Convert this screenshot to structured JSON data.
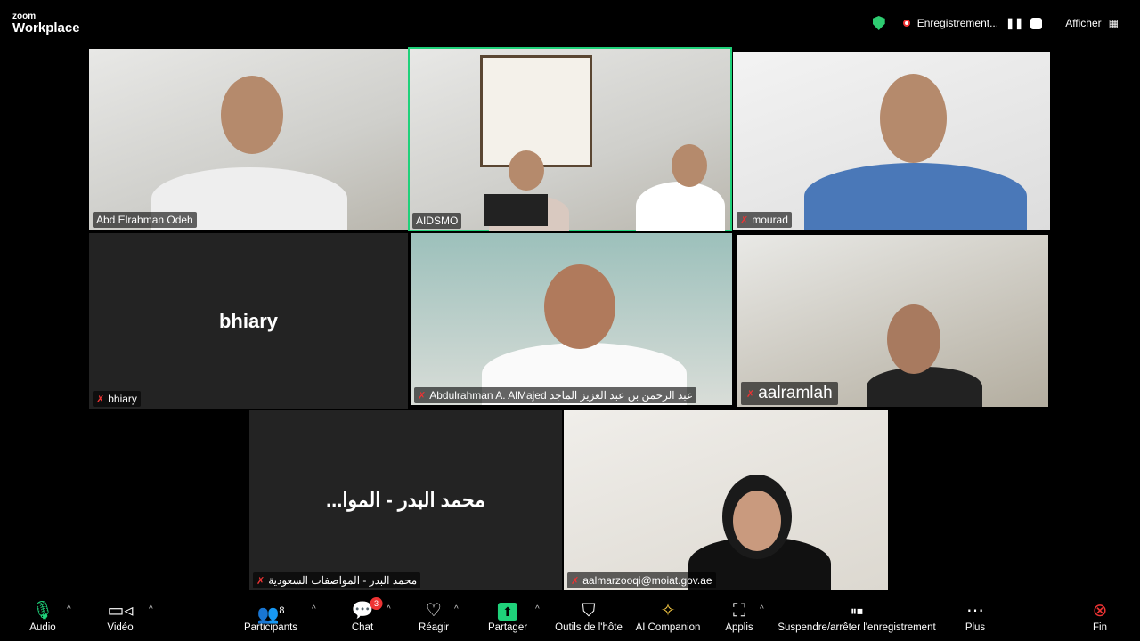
{
  "app": {
    "logo_small": "zoom",
    "logo_big": "Workplace"
  },
  "topbar": {
    "recording_label": "Enregistrement...",
    "view_label": "Afficher"
  },
  "tiles": [
    {
      "name": "Abd Elrahman Odeh"
    },
    {
      "name": "AIDSMO"
    },
    {
      "name": "mourad"
    },
    {
      "name": "bhiary",
      "display": "bhiary"
    },
    {
      "name": "Abdulrahman A. AlMajed عبد الرحمن بن عبد العزيز الماجد"
    },
    {
      "name": "aalramlah"
    },
    {
      "name": "محمد البدر - المواصفات السعودية",
      "display": "...محمد البدر - الموا"
    },
    {
      "name": "aalmarzooqi@moiat.gov.ae"
    }
  ],
  "toolbar": {
    "audio": "Audio",
    "video": "Vidéo",
    "participants": "Participants",
    "participants_count": "8",
    "chat": "Chat",
    "chat_badge": "3",
    "react": "Réagir",
    "share": "Partager",
    "host_tools": "Outils de l'hôte",
    "ai": "AI Companion",
    "apps": "Applis",
    "recording": "Suspendre/arrêter l'enregistrement",
    "more": "Plus",
    "end": "Fin"
  },
  "colors": {
    "active_speaker": "#1fd17a",
    "share": "#1fd17a",
    "end": "#e33"
  }
}
